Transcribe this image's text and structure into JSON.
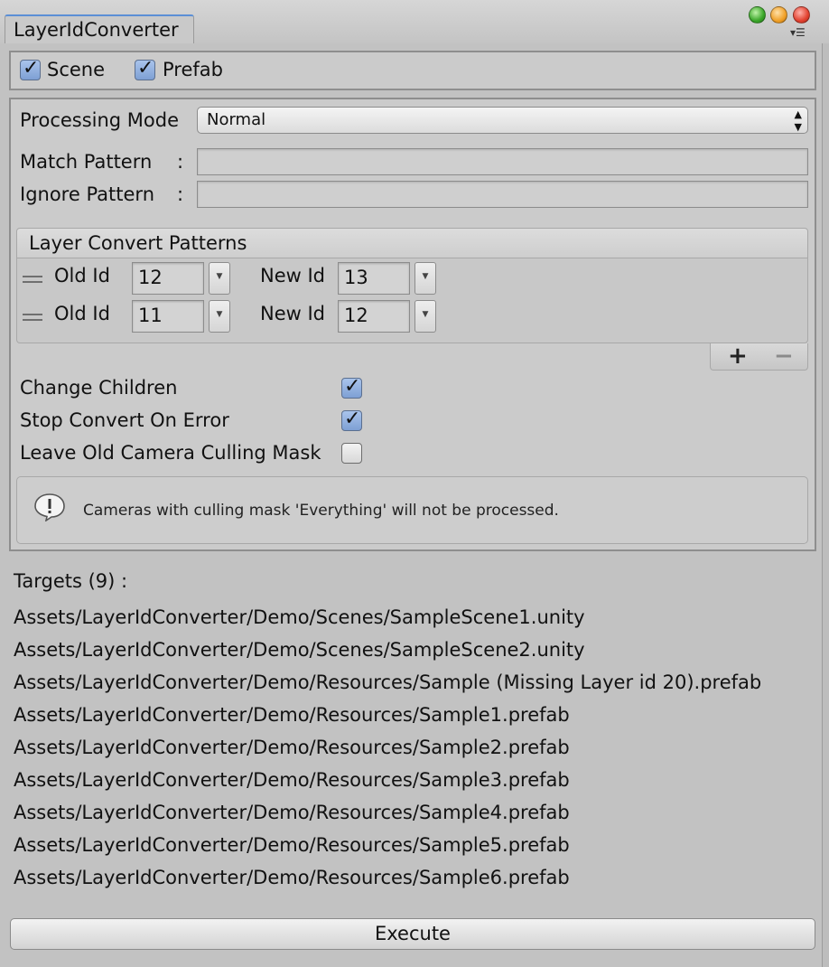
{
  "window": {
    "tab_title": "LayerIdConverter",
    "menu_icon": "context-menu-icon"
  },
  "filters": {
    "scene_label": "Scene",
    "scene_checked": true,
    "prefab_label": "Prefab",
    "prefab_checked": true
  },
  "settings": {
    "processing_mode_label": "Processing Mode",
    "processing_mode_value": "Normal",
    "match_pattern_label": "Match Pattern",
    "match_pattern_colon": ":",
    "match_pattern_value": "",
    "ignore_pattern_label": "Ignore Pattern",
    "ignore_pattern_colon": ":",
    "ignore_pattern_value": ""
  },
  "patterns": {
    "header": "Layer Convert Patterns",
    "rows": [
      {
        "old_label": "Old Id",
        "old_value": "12",
        "new_label": "New Id",
        "new_value": "13"
      },
      {
        "old_label": "Old Id",
        "old_value": "11",
        "new_label": "New Id",
        "new_value": "12"
      }
    ],
    "add_label": "+",
    "remove_label": "−"
  },
  "options": [
    {
      "label": "Change Children",
      "checked": true
    },
    {
      "label": "Stop Convert On Error",
      "checked": true
    },
    {
      "label": "Leave Old Camera Culling Mask",
      "checked": false
    }
  ],
  "help": {
    "icon": "info-icon",
    "text": "Cameras with culling mask 'Everything' will not be processed."
  },
  "targets": {
    "header": "Targets (9) :",
    "items": [
      "Assets/LayerIdConverter/Demo/Scenes/SampleScene1.unity",
      "Assets/LayerIdConverter/Demo/Scenes/SampleScene2.unity",
      "Assets/LayerIdConverter/Demo/Resources/Sample (Missing Layer id 20).prefab",
      "Assets/LayerIdConverter/Demo/Resources/Sample1.prefab",
      "Assets/LayerIdConverter/Demo/Resources/Sample2.prefab",
      "Assets/LayerIdConverter/Demo/Resources/Sample3.prefab",
      "Assets/LayerIdConverter/Demo/Resources/Sample4.prefab",
      "Assets/LayerIdConverter/Demo/Resources/Sample5.prefab",
      "Assets/LayerIdConverter/Demo/Resources/Sample6.prefab"
    ]
  },
  "execute_label": "Execute"
}
